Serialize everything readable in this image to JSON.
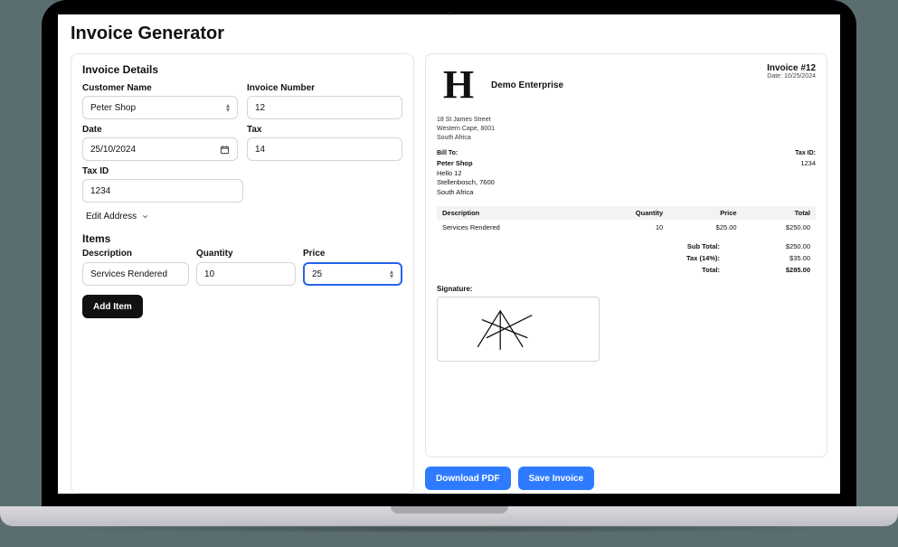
{
  "title": "Invoice Generator",
  "form": {
    "section_title": "Invoice Details",
    "customer_name_label": "Customer Name",
    "customer_name_value": "Peter Shop",
    "invoice_number_label": "Invoice Number",
    "invoice_number_value": "12",
    "date_label": "Date",
    "date_value": "25/10/2024",
    "tax_label": "Tax",
    "tax_value": "14",
    "tax_id_label": "Tax ID",
    "tax_id_value": "1234",
    "edit_address_label": "Edit Address",
    "items_heading": "Items",
    "col_description": "Description",
    "col_quantity": "Quantity",
    "col_price": "Price",
    "item": {
      "description": "Services Rendered",
      "quantity": "10",
      "price": "25"
    },
    "add_item_label": "Add Item"
  },
  "preview": {
    "logo_letter": "H",
    "company_name": "Demo Enterprise",
    "invoice_heading": "Invoice #12",
    "invoice_date": "Date: 10/25/2024",
    "sender_address": [
      "18 St James Street",
      "Western Cape, 8001",
      "South Africa"
    ],
    "bill_to_label": "Bill To:",
    "tax_id_label": "Tax ID:",
    "tax_id_value": "1234",
    "customer_name": "Peter Shop",
    "customer_address": [
      "Hello 12",
      "Stellenbosch, 7600",
      "South Africa"
    ],
    "th_description": "Description",
    "th_quantity": "Quantity",
    "th_price": "Price",
    "th_total": "Total",
    "row": {
      "description": "Services Rendered",
      "quantity": "10",
      "price": "$25.00",
      "total": "$250.00"
    },
    "subtotal_label": "Sub Total:",
    "subtotal_value": "$250.00",
    "tax_label": "Tax (14%):",
    "tax_value": "$35.00",
    "total_label": "Total:",
    "total_value": "$285.00",
    "signature_label": "Signature:"
  },
  "actions": {
    "download_pdf": "Download PDF",
    "save_invoice": "Save Invoice"
  }
}
